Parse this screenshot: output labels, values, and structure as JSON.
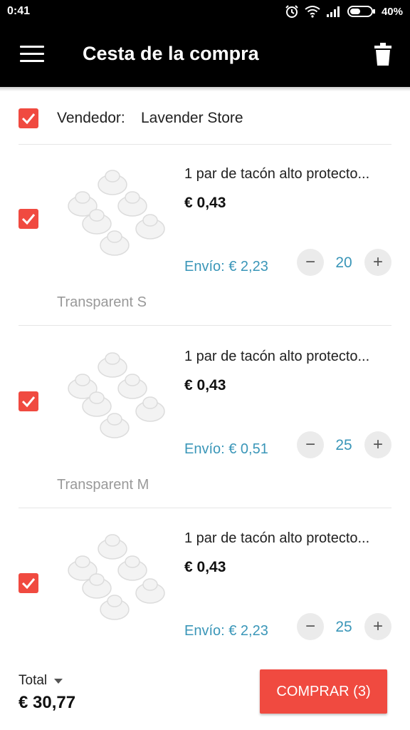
{
  "status_bar": {
    "time": "0:41",
    "battery": "40%"
  },
  "app_bar": {
    "title": "Cesta de la compra"
  },
  "vendor": {
    "label": "Vendedor:",
    "name": "Lavender Store",
    "checked": true
  },
  "items": [
    {
      "title": "1 par de tacón alto protecto...",
      "price": "€ 0,43",
      "shipping": "Envío: € 2,23",
      "quantity": "20",
      "variant": "Transparent S",
      "checked": true
    },
    {
      "title": "1 par de tacón alto protecto...",
      "price": "€ 0,43",
      "shipping": "Envío: € 0,51",
      "quantity": "25",
      "variant": "Transparent M",
      "checked": true
    },
    {
      "title": "1 par de tacón alto protecto...",
      "price": "€ 0,43",
      "shipping": "Envío: € 2,23",
      "quantity": "25",
      "checked": true
    }
  ],
  "qty_controls": {
    "minus": "−",
    "plus": "+"
  },
  "footer": {
    "total_label": "Total",
    "total_value": "€ 30,77",
    "buy_label": "COMPRAR (3)"
  },
  "colors": {
    "accent": "#f04a40",
    "link": "#3a96b8",
    "header": "#000000"
  },
  "icons": [
    "menu-icon",
    "trash-icon",
    "alarm-icon",
    "wifi-icon",
    "signal-icon",
    "battery-icon",
    "checkmark-icon",
    "dropdown-caret-icon"
  ]
}
